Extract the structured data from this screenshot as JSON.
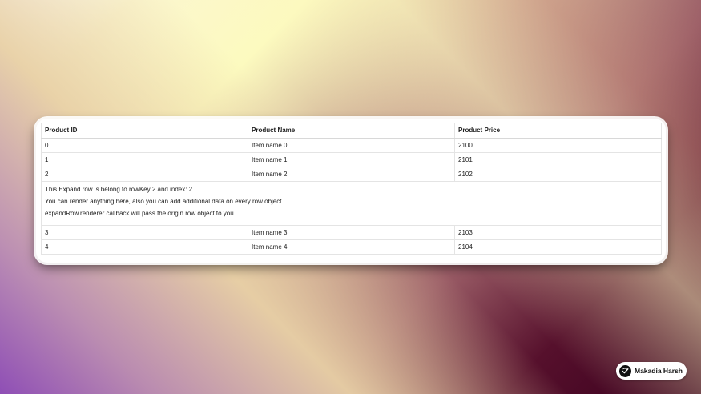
{
  "table": {
    "headers": [
      "Product ID",
      "Product Name",
      "Product Price"
    ],
    "rows_before": [
      {
        "id": "0",
        "name": "Item name 0",
        "price": "2100"
      },
      {
        "id": "1",
        "name": "Item name 1",
        "price": "2101"
      },
      {
        "id": "2",
        "name": "Item name 2",
        "price": "2102"
      }
    ],
    "expanded": {
      "line1": "This Expand row is belong to rowKey 2 and index: 2",
      "line2": "You can render anything here, also you can add additional data on every row object",
      "line3": "expandRow.renderer callback will pass the origin row object to you"
    },
    "rows_after": [
      {
        "id": "3",
        "name": "Item name 3",
        "price": "2103"
      },
      {
        "id": "4",
        "name": "Item name 4",
        "price": "2104"
      }
    ]
  },
  "author_badge": {
    "name": "Makadia Harsh",
    "icon": "author-logo-icon"
  }
}
